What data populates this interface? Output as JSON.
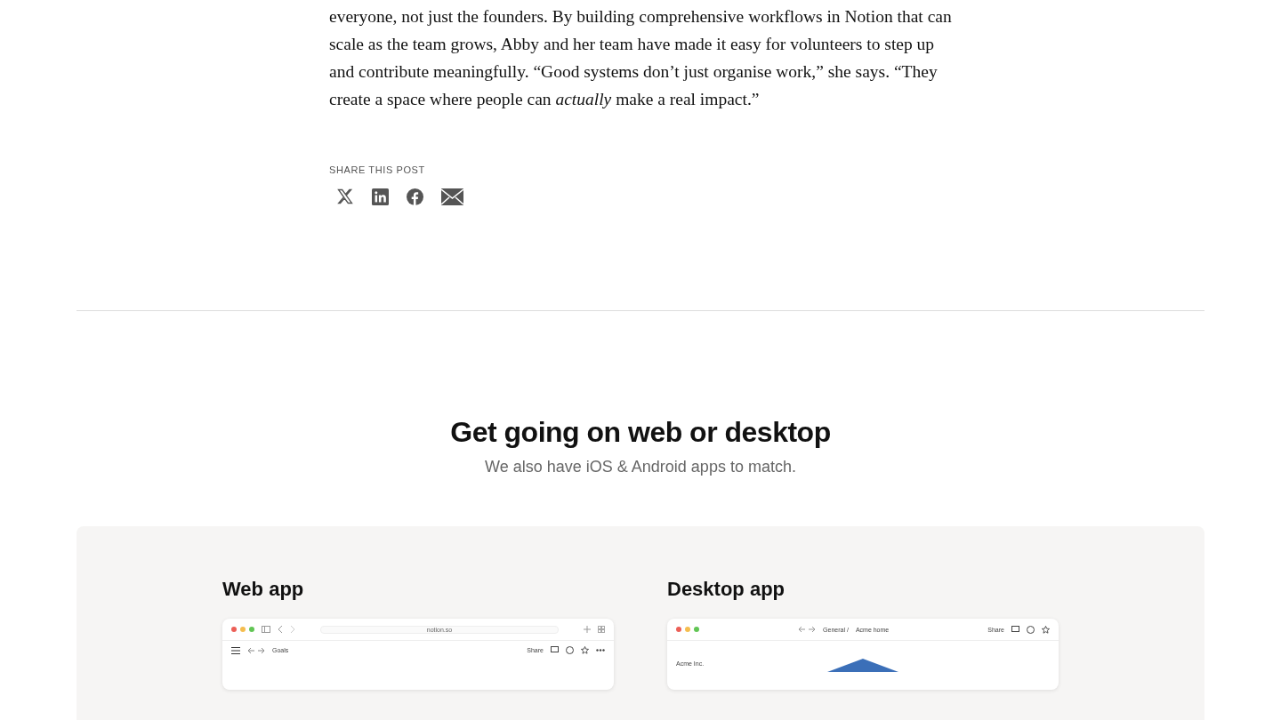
{
  "article": {
    "paragraph": "everyone, not just the founders. By building comprehensive workflows in Notion that can scale as the team grows, Abby and her team have made it easy for volunteers to step up and contribute meaningfully. “Good systems don’t just organise work,” she says. “They create a space where people can *actually* make a real impact.”"
  },
  "share": {
    "label": "SHARE THIS POST"
  },
  "download": {
    "heading": "Get going on web or desktop",
    "subtitle": "We also have iOS & Android apps to match.",
    "apps": [
      {
        "kind": "web",
        "title": "Web app",
        "address": "notion.so",
        "page": "Goals",
        "share": "Share"
      },
      {
        "kind": "desktop",
        "title": "Desktop app",
        "breadcrumb": "General /",
        "page": "Acme home",
        "share": "Share",
        "workspace": "Acme Inc."
      }
    ]
  }
}
